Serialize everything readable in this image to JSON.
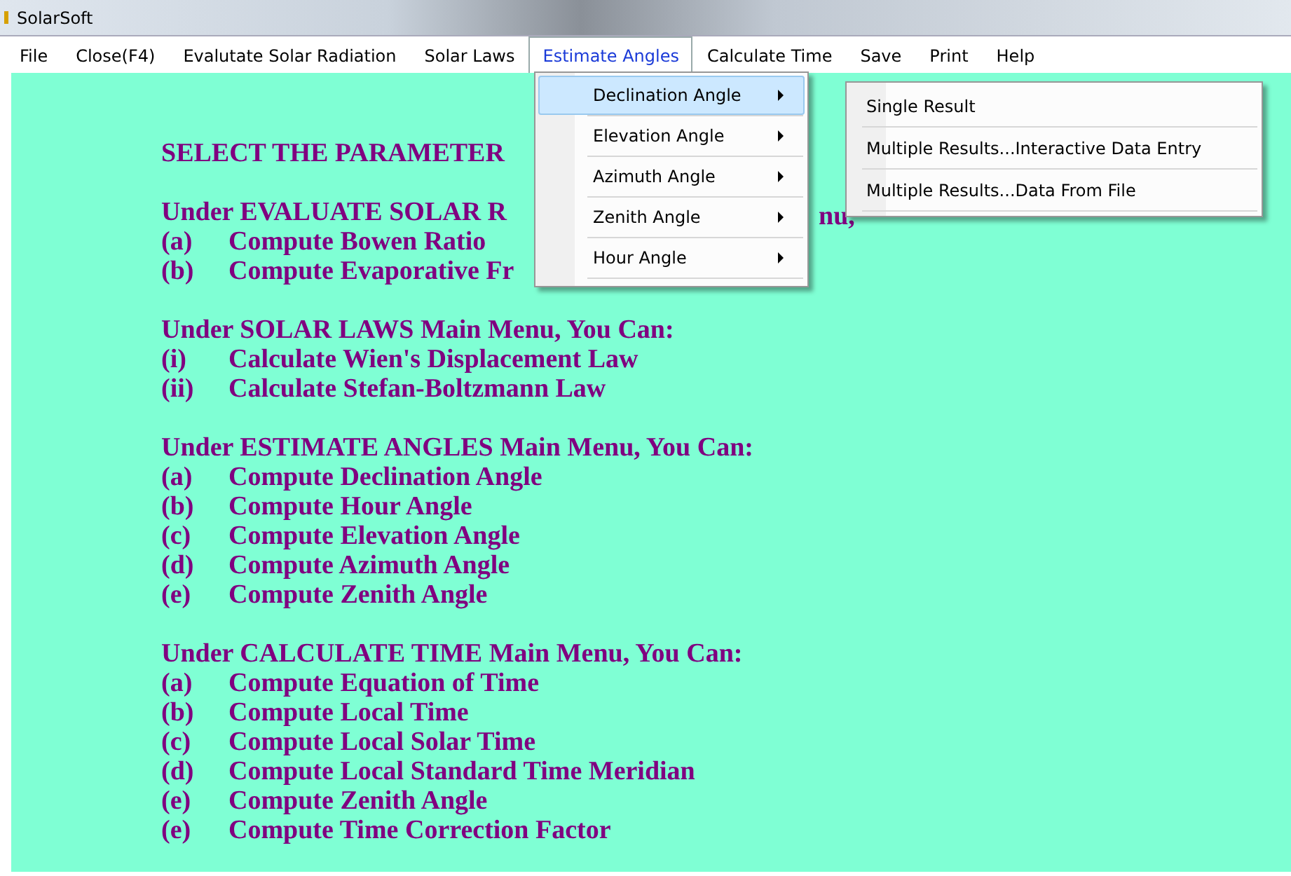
{
  "window": {
    "title": "SolarSoft"
  },
  "menu_bar": [
    {
      "label": "File",
      "selected": false
    },
    {
      "label": "Close(F4)",
      "selected": false
    },
    {
      "label": "Evalutate Solar Radiation",
      "selected": false
    },
    {
      "label": "Solar Laws",
      "selected": false
    },
    {
      "label": "Estimate Angles",
      "selected": true
    },
    {
      "label": "Calculate Time",
      "selected": false
    },
    {
      "label": "Save",
      "selected": false
    },
    {
      "label": "Print",
      "selected": false
    },
    {
      "label": "Help",
      "selected": false
    }
  ],
  "dropdown": [
    {
      "label": "Declination Angle",
      "selected": true,
      "has_submenu": true
    },
    {
      "label": "Elevation Angle",
      "selected": false,
      "has_submenu": true
    },
    {
      "label": "Azimuth Angle",
      "selected": false,
      "has_submenu": true
    },
    {
      "label": "Zenith Angle",
      "selected": false,
      "has_submenu": true
    },
    {
      "label": "Hour Angle",
      "selected": false,
      "has_submenu": true
    }
  ],
  "submenu": [
    {
      "label": "Single Result",
      "selected": false
    },
    {
      "label": "Multiple Results...Interactive Data Entry",
      "selected": false
    },
    {
      "label": "Multiple Results...Data From File",
      "selected": false
    }
  ],
  "sections": [
    {
      "heading": "SELECT THE PARAMETER"
    },
    {
      "heading": "Under EVALUATE SOLAR R",
      "heading_tail": "nu,",
      "items": [
        {
          "marker": "(a)",
          "text": "Compute Bowen Ratio"
        },
        {
          "marker": "(b)",
          "text": "Compute Evaporative Fr"
        }
      ]
    },
    {
      "heading": "Under SOLAR LAWS Main Menu, You Can:",
      "items": [
        {
          "marker": "(i)",
          "text": "Calculate Wien's Displacement Law"
        },
        {
          "marker": "(ii)",
          "text": "Calculate Stefan-Boltzmann Law"
        }
      ]
    },
    {
      "heading": "Under ESTIMATE ANGLES Main Menu, You Can:",
      "items": [
        {
          "marker": "(a)",
          "text": "Compute Declination Angle"
        },
        {
          "marker": "(b)",
          "text": "Compute Hour Angle"
        },
        {
          "marker": "(c)",
          "text": "Compute Elevation Angle"
        },
        {
          "marker": "(d)",
          "text": "Compute Azimuth Angle"
        },
        {
          "marker": "(e)",
          "text": "Compute Zenith Angle"
        }
      ]
    },
    {
      "heading": "Under CALCULATE TIME Main Menu, You Can:",
      "items": [
        {
          "marker": "(a)",
          "text": "Compute Equation of Time"
        },
        {
          "marker": "(b)",
          "text": "Compute Local Time"
        },
        {
          "marker": "(c)",
          "text": "Compute Local Solar Time"
        },
        {
          "marker": "(d)",
          "text": "Compute Local Standard Time Meridian"
        },
        {
          "marker": "(e)",
          "text": "Compute Zenith Angle"
        },
        {
          "marker": "(e)",
          "text": "Compute Time Correction Factor"
        }
      ]
    }
  ]
}
